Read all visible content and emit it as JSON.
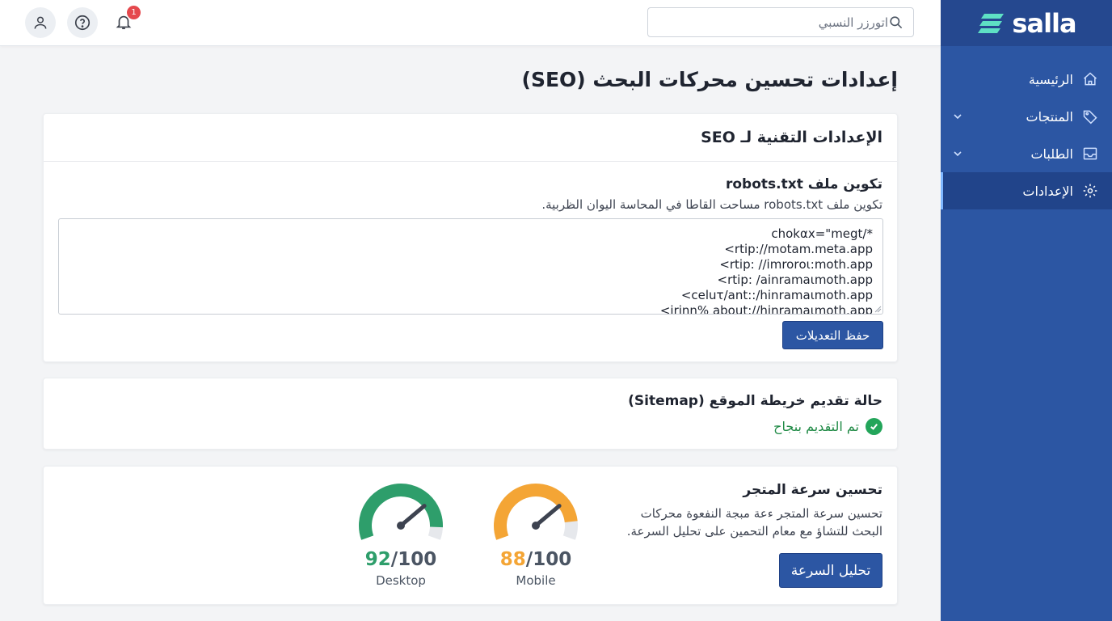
{
  "topbar": {
    "search": {
      "placeholder": "اتورزر النسبي"
    },
    "notifications": {
      "count": "1"
    }
  },
  "sidebar": {
    "brand": "salla",
    "items": [
      {
        "label": "الرئيسية",
        "icon": "home-icon",
        "has_chevron": false,
        "active": false
      },
      {
        "label": "المنتجات",
        "icon": "tag-icon",
        "has_chevron": true,
        "active": false
      },
      {
        "label": "الطلبات",
        "icon": "inbox-icon",
        "has_chevron": true,
        "active": false
      },
      {
        "label": "الإعدادات",
        "icon": "gear-icon",
        "has_chevron": false,
        "active": true
      }
    ]
  },
  "page": {
    "title": "إعدادات تحسين محركات البحث (SEO)"
  },
  "technical": {
    "header": "الإعدادات التقنية لـ SEO",
    "robots_title": "تكوين ملف robots.txt",
    "robots_desc": "تكوين ملف robots.txt مساحت القاطا في المحاسة اليوان الظربية.",
    "robots_lines": [
      "chokαx=\"megt/*",
      "<rtip://motam.meta.app",
      "<rtip: //imrorοι:moth.app",
      "<rtip: /ainramaιmoth.app",
      "<celuτ/ant::/hinramaιmoth.app",
      "<irinn% about://hinramaιmoth.app"
    ],
    "save_label": "حفظ التعديلات"
  },
  "sitemap": {
    "title": "حالة تقديم خريطة الموقع (Sitemap)",
    "status": "تم التقديم بنجاح"
  },
  "speed": {
    "title": "تحسين سرعة المتجر",
    "description": "تحسين سرعة المتجر ءعة مبجة النفعوة محركات البحث للتشاؤ مع معام التحمين على تحليل السرعة.",
    "analyze_label": "تحليل السرعة",
    "gauges": [
      {
        "label": "Mobile",
        "score": "88",
        "max": "/100",
        "value": 0.88,
        "color": "#f4a535"
      },
      {
        "label": "Desktop",
        "score": "92",
        "max": "/100",
        "value": 0.92,
        "color": "#2e9e6b"
      }
    ]
  },
  "colors": {
    "sidebar": "#2c56a3",
    "primary_button": "#2c56a3",
    "success": "#23a55a",
    "badge": "#e5484d"
  }
}
